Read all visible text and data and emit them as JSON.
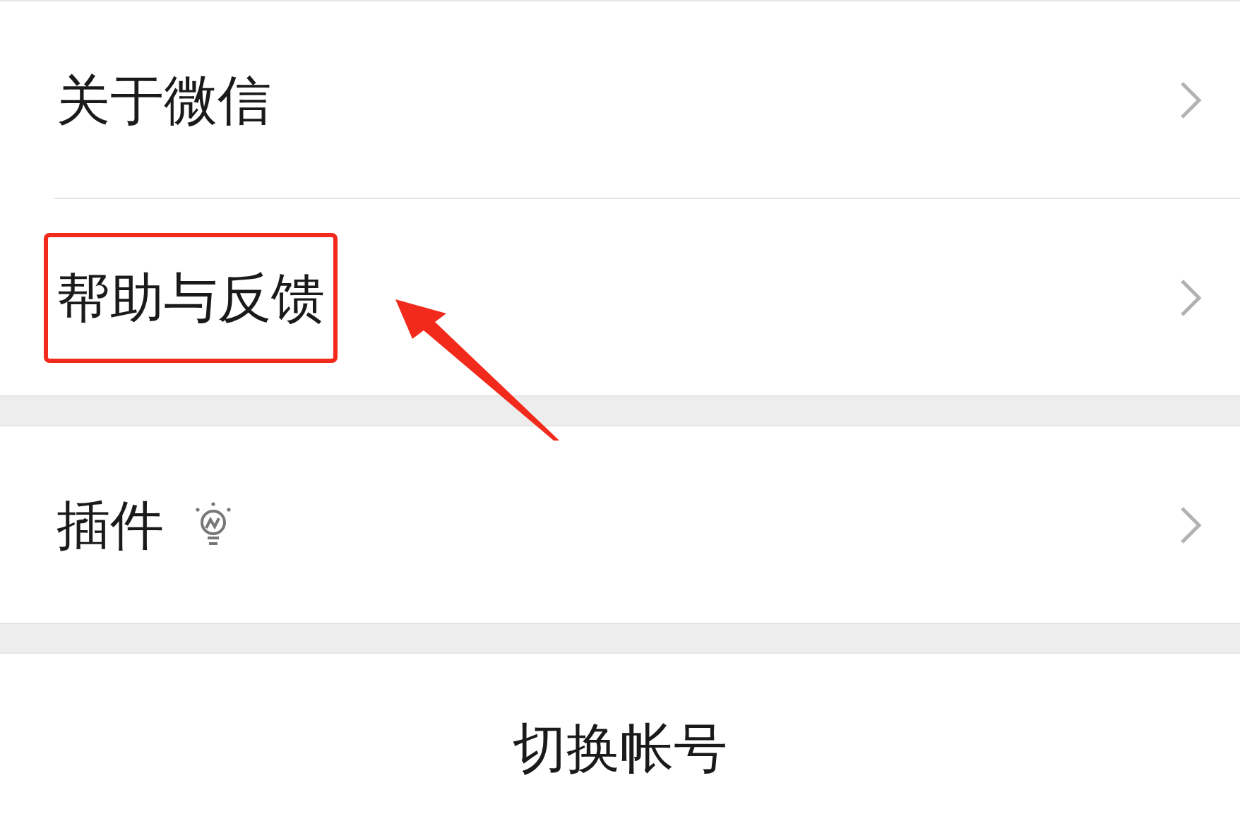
{
  "groups": [
    {
      "items": [
        {
          "label": "关于微信",
          "kind": "plain",
          "highlighted": false
        },
        {
          "label": "帮助与反馈",
          "kind": "plain",
          "highlighted": true
        }
      ]
    },
    {
      "items": [
        {
          "label": "插件",
          "kind": "with-icon",
          "highlighted": false
        }
      ]
    }
  ],
  "switch_account": {
    "label": "切换帐号"
  }
}
